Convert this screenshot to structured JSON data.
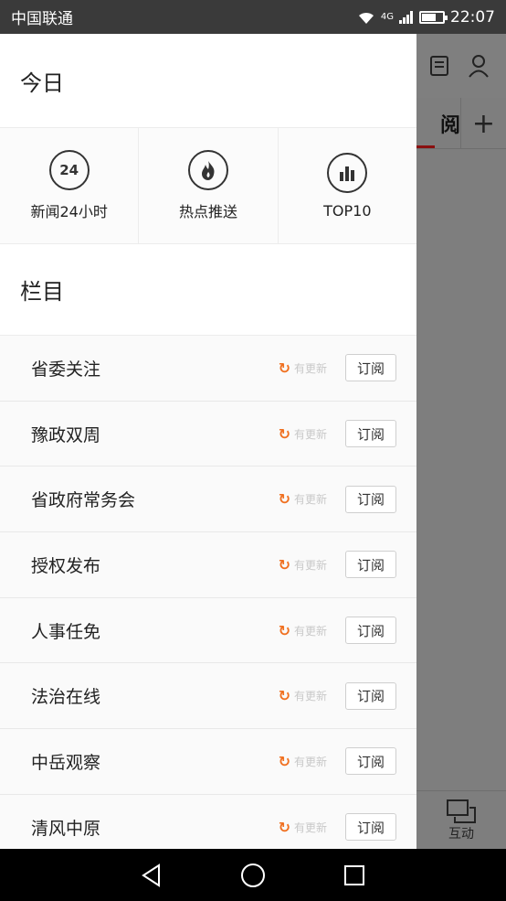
{
  "status": {
    "carrier": "中国联通",
    "network": "4G",
    "time": "22:07",
    "battery_level": 0.7
  },
  "background_app": {
    "tab_label": "阅",
    "add_label": "+",
    "bottom_nav_label": "互动"
  },
  "drawer": {
    "today_title": "今日",
    "today_items": [
      {
        "label": "新闻24小时",
        "icon_text": "24"
      },
      {
        "label": "热点推送",
        "icon_text": ""
      },
      {
        "label": "TOP10",
        "icon_text": ""
      }
    ],
    "columns_title": "栏目",
    "update_text": "有更新",
    "subscribe_label": "订阅",
    "channels": [
      {
        "name": "省委关注"
      },
      {
        "name": "豫政双周"
      },
      {
        "name": "省政府常务会"
      },
      {
        "name": "授权发布"
      },
      {
        "name": "人事任免"
      },
      {
        "name": "法治在线"
      },
      {
        "name": "中岳观察"
      },
      {
        "name": "清风中原"
      }
    ]
  },
  "colors": {
    "accent_update": "#f07020",
    "tab_underline": "#8a0f0f"
  }
}
